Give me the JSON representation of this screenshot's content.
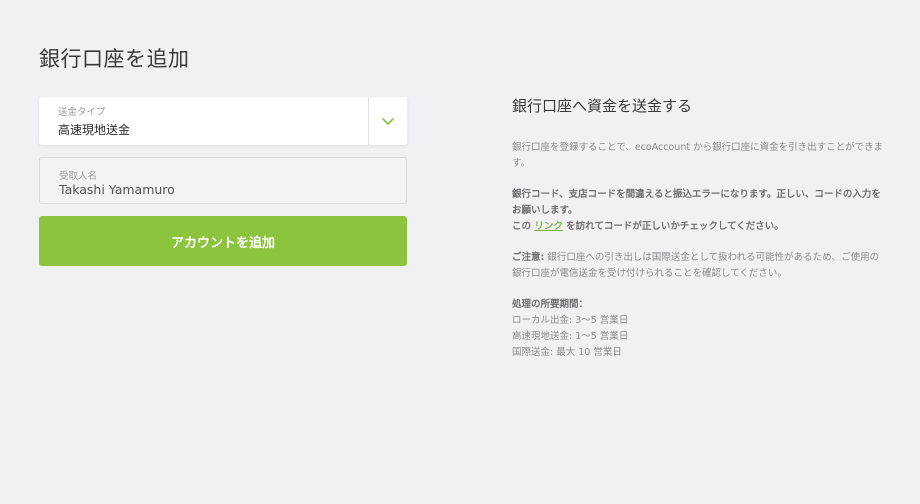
{
  "page": {
    "title": "銀行口座を追加"
  },
  "form": {
    "transfer_type": {
      "label": "送金タイプ",
      "value": "高速現地送金"
    },
    "recipient_name": {
      "label": "受取人名",
      "value": "Takashi Yamamuro"
    },
    "submit_label": "アカウントを追加"
  },
  "info": {
    "title": "銀行口座へ資金を送金する",
    "intro": "銀行口座を登録することで、ecoAccount から銀行口座に資金を引き出すことができます。",
    "warning_line1": "銀行コード、支店コードを間違えると振込エラーになります。正しい、コードの入力をお願いします。",
    "warning_prefix": "この",
    "warning_link": "リンク",
    "warning_suffix": "を訪れてコードが正しいかチェックしてください。",
    "notice_label": "ご注意:",
    "notice_text": "銀行口座への引き出しは国際送金として扱われる可能性があるため、ご使用の銀行口座が電信送金を受け付けられることを確認してください。",
    "processing_title": "処理の所要期間：",
    "processing_items": [
      "ローカル出金: 3〜5 営業日",
      "高速現地送金: 1〜5 営業日",
      "国際送金: 最大 10 営業日"
    ]
  },
  "icons": {
    "dropdown": "chevron-down-icon"
  },
  "colors": {
    "accent": "#8cc43e",
    "link": "#7cb342",
    "background": "#f1f1f3"
  }
}
